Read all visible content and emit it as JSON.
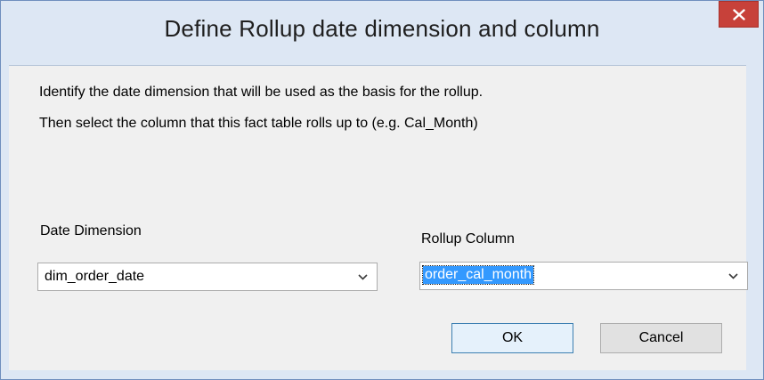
{
  "dialog": {
    "title": "Define Rollup date dimension and column",
    "close_icon": "close-icon"
  },
  "instructions": {
    "line1": "Identify the date dimension that will be used as the basis for the rollup.",
    "line2": "Then select the column that this fact table rolls up to (e.g. Cal_Month)"
  },
  "date_dimension": {
    "label": "Date Dimension",
    "value": "dim_order_date"
  },
  "rollup_column": {
    "label": "Rollup Column",
    "value": "order_cal_month"
  },
  "buttons": {
    "ok_label": "OK",
    "cancel_label": "Cancel"
  },
  "colors": {
    "close_button": "#c7413a",
    "selection_highlight": "#3399ff",
    "title_background": "#dde7f4"
  }
}
